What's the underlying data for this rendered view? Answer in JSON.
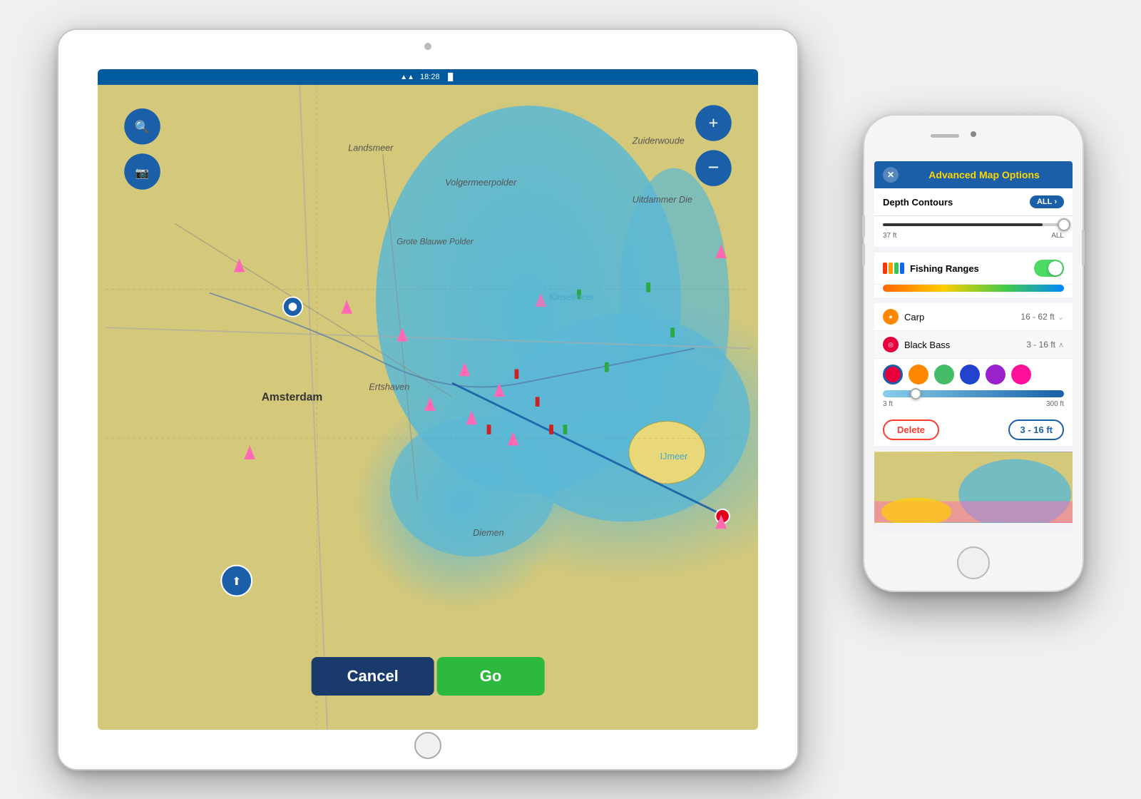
{
  "tablet": {
    "status_time": "18:28",
    "wifi_symbol": "📶",
    "battery_symbol": "🔋"
  },
  "map": {
    "cancel_label": "Cancel",
    "go_label": "Go",
    "place_labels": [
      "Landsmeer",
      "Zuiderwoude",
      "Volgermeerpolder",
      "Grote Blauwe Polder",
      "Uitdammer Die",
      "Kinselmeer",
      "Ertshaven",
      "Amsterdam",
      "Diemen",
      "IJmeer"
    ]
  },
  "phone": {
    "header": {
      "close_label": "✕",
      "title": "Advanced Map Options"
    },
    "depth_contours": {
      "label": "Depth Contours",
      "badge_label": "ALL",
      "slider_min": "37 ft",
      "slider_max": "ALL"
    },
    "fishing_ranges": {
      "label": "Fishing Ranges"
    },
    "fish_list": [
      {
        "name": "Carp",
        "range": "16 - 62 ft",
        "icon_color": "#ff8800",
        "icon_symbol": "🐟"
      },
      {
        "name": "Black Bass",
        "range": "3 - 16 ft",
        "icon_color": "#e8003d",
        "icon_symbol": "🐟"
      }
    ],
    "black_bass": {
      "swatches": [
        "#e8003d",
        "#ff8800",
        "#44bb66",
        "#2244cc",
        "#9922cc",
        "#ff1199"
      ],
      "range_min": "3 ft",
      "range_max": "300 ft",
      "delete_label": "Delete",
      "range_chip_label": "3 - 16 ft"
    }
  }
}
